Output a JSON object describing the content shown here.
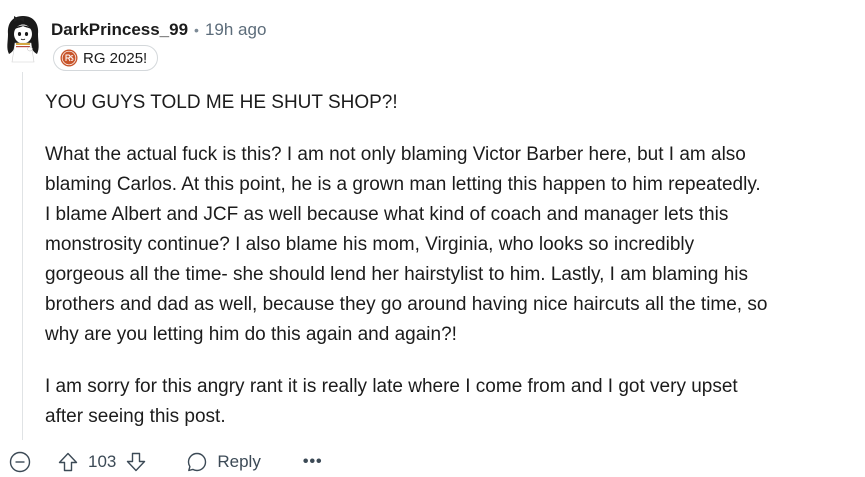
{
  "comment": {
    "username": "DarkPrincess_99",
    "separator": "•",
    "time_ago": "19h ago",
    "flair": {
      "icon": "tournament-logo-icon",
      "label": "RG 2025!"
    },
    "paragraphs": [
      "YOU GUYS TOLD ME HE SHUT SHOP?!",
      "What the actual fuck is this? I am not only blaming Victor Barber here, but I am also\nblaming Carlos. At this point, he is a grown man letting this happen to him repeatedly.\nI blame Albert and JCF as well because what kind of coach and manager lets this\nmonstrosity continue? I also blame his mom, Virginia, who looks so incredibly\ngorgeous all the time- she should lend her hairstylist to him. Lastly, I am blaming his\nbrothers and dad as well, because they go around having nice haircuts all the time, so\nwhy are you letting him do this again and again?!",
      "I am sorry for this angry rant it is really late where I come from and I got very upset\nafter seeing this post."
    ]
  },
  "actions": {
    "collapse_icon": "minus-circle-icon",
    "upvote_icon": "upvote-arrow-icon",
    "score": "103",
    "downvote_icon": "downvote-arrow-icon",
    "reply_icon": "speech-bubble-icon",
    "reply_label": "Reply",
    "more_label": "•••"
  },
  "colors": {
    "text": "#1c1c1c",
    "muted": "#5c6c7a",
    "thread_line": "#e0e3e5",
    "flair_border": "#d4d8db",
    "flair_logo": "#c8552b"
  }
}
